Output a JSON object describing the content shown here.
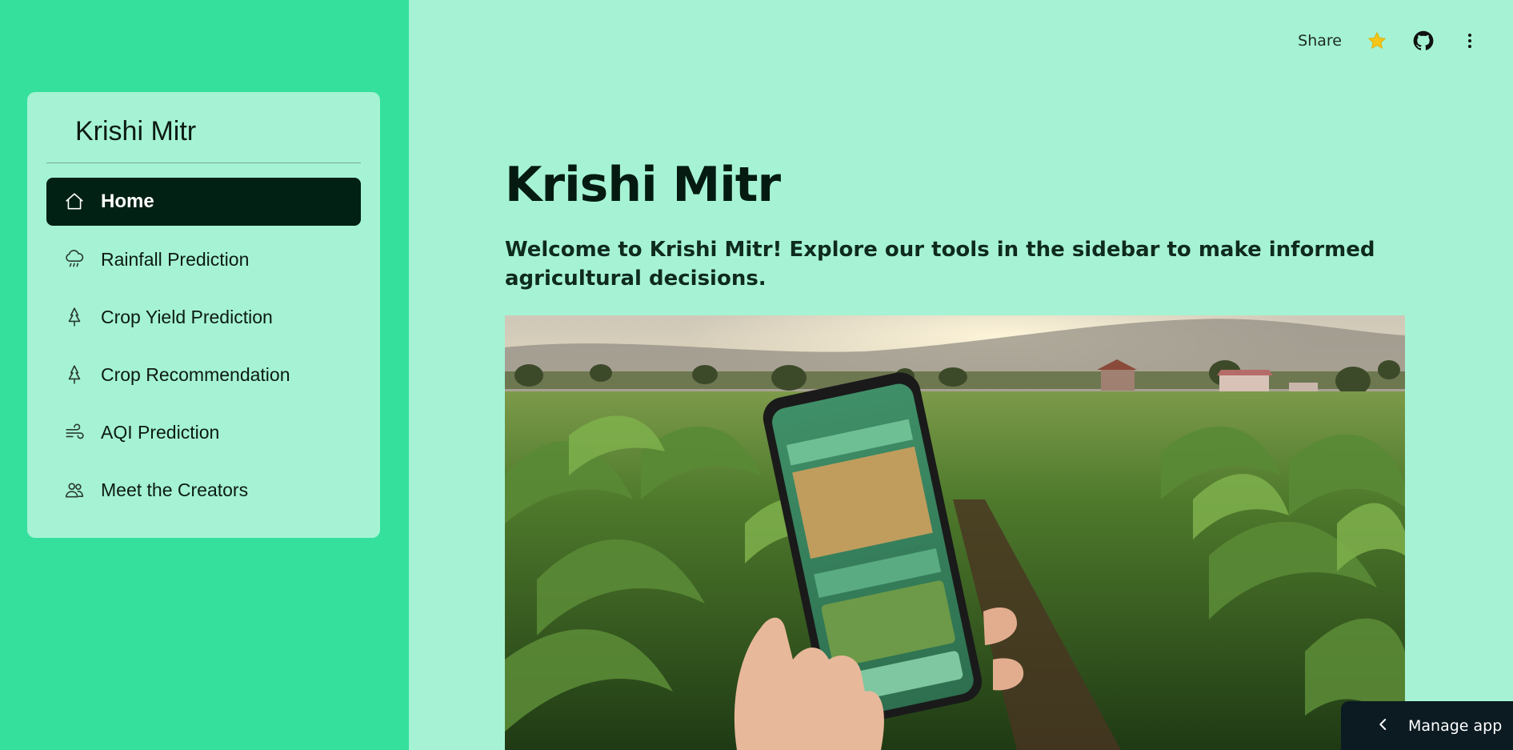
{
  "sidebar": {
    "title": "Krishi Mitr",
    "items": [
      {
        "label": "Home",
        "icon": "house-icon",
        "active": true
      },
      {
        "label": "Rainfall Prediction",
        "icon": "cloud-rain-icon"
      },
      {
        "label": "Crop Yield Prediction",
        "icon": "tree-icon"
      },
      {
        "label": "Crop Recommendation",
        "icon": "tree-icon"
      },
      {
        "label": "AQI Prediction",
        "icon": "wind-icon"
      },
      {
        "label": "Meet the Creators",
        "icon": "people-icon"
      }
    ]
  },
  "topbar": {
    "share_label": "Share",
    "icons": [
      "star-icon",
      "github-icon",
      "more-vertical-icon"
    ],
    "star_color": "#f5c518"
  },
  "main": {
    "title": "Krishi Mitr",
    "subtitle": "Welcome to Krishi Mitr! Explore our tools in the sidebar to make informed agricultural decisions.",
    "hero_image": "farmer holding smartphone in crop field"
  },
  "manage_app": {
    "label": "Manage app",
    "icon": "chevron-left-icon"
  },
  "colors": {
    "sidebar_bg": "#34e09c",
    "main_bg": "#a5f3d4",
    "active_item_bg": "#002114",
    "manage_bg": "#0c1b22"
  }
}
